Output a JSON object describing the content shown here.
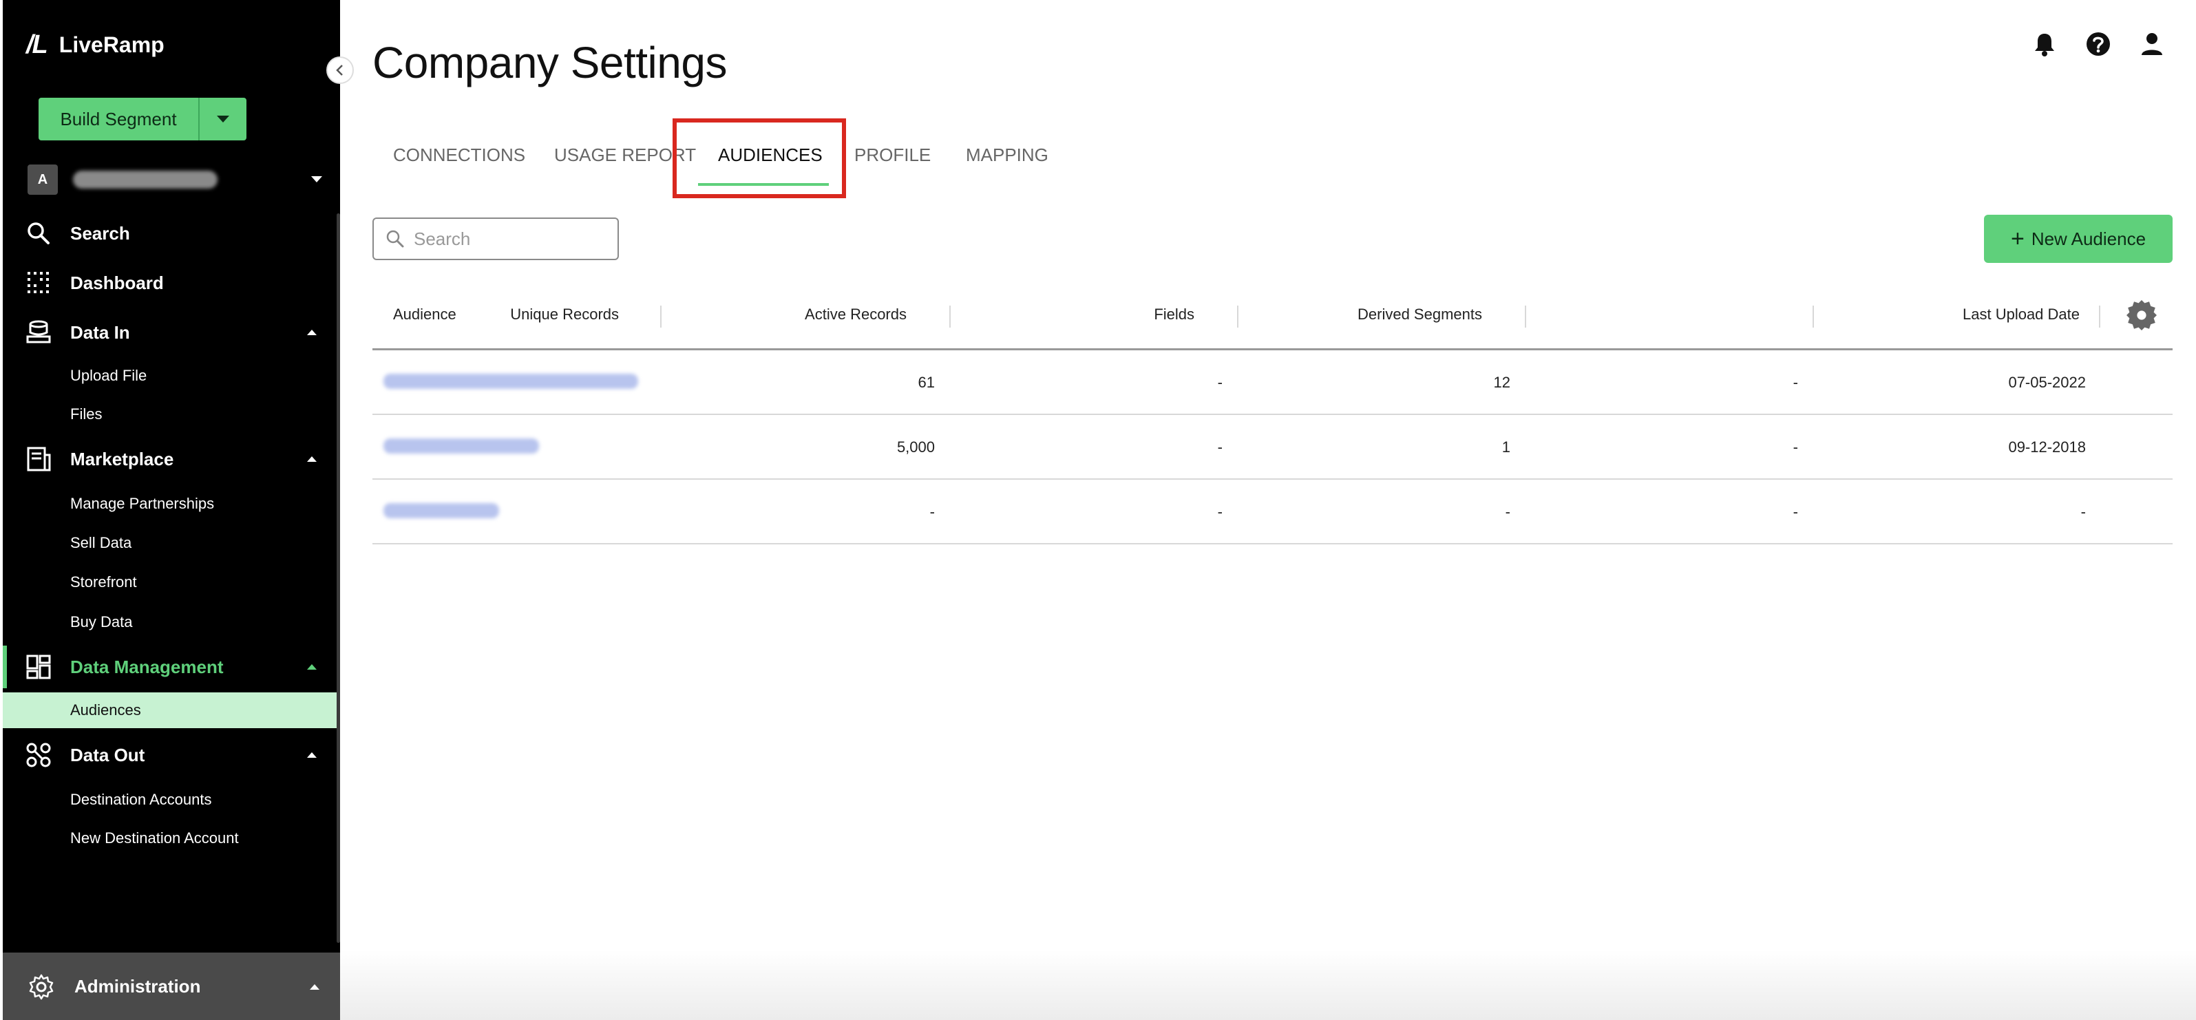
{
  "app": {
    "brand_mark": "/L",
    "brand_name": "LiveRamp"
  },
  "sidebar": {
    "build_segment_label": "Build Segment",
    "account_initial": "A",
    "nav": [
      {
        "label": "Search",
        "icon": "search-icon"
      },
      {
        "label": "Dashboard",
        "icon": "dashboard-icon"
      },
      {
        "label": "Data In",
        "icon": "data-in-icon",
        "expanded": true,
        "children": [
          "Upload File",
          "Files"
        ]
      },
      {
        "label": "Marketplace",
        "icon": "marketplace-icon",
        "expanded": true,
        "children": [
          "Manage Partnerships",
          "Sell Data",
          "Storefront",
          "Buy Data"
        ]
      },
      {
        "label": "Data Management",
        "icon": "data-management-icon",
        "expanded": true,
        "active": true,
        "children": [
          "Audiences"
        ],
        "active_child": "Audiences"
      },
      {
        "label": "Data Out",
        "icon": "data-out-icon",
        "expanded": true,
        "children": [
          "Destination Accounts",
          "New Destination Account"
        ]
      }
    ],
    "admin_label": "Administration"
  },
  "header": {
    "title": "Company Settings"
  },
  "tabs": [
    {
      "label": "CONNECTIONS"
    },
    {
      "label": "USAGE REPORT"
    },
    {
      "label": "AUDIENCES",
      "active": true
    },
    {
      "label": "PROFILE"
    },
    {
      "label": "MAPPING"
    }
  ],
  "toolbar": {
    "search_placeholder": "Search",
    "new_audience_label": "New Audience"
  },
  "table": {
    "columns": [
      "Audience",
      "Unique Records",
      "Active Records",
      "Fields",
      "Derived Segments",
      "Last Upload Date"
    ],
    "rows": [
      {
        "unique_records": "61",
        "active_records": "-",
        "fields": "12",
        "derived_segments": "-",
        "last_upload_date": "07-05-2022"
      },
      {
        "unique_records": "5,000",
        "active_records": "-",
        "fields": "1",
        "derived_segments": "-",
        "last_upload_date": "09-12-2018"
      },
      {
        "unique_records": "-",
        "active_records": "-",
        "fields": "-",
        "derived_segments": "-",
        "last_upload_date": "-"
      }
    ]
  },
  "colors": {
    "accent": "#5fd07b",
    "highlight": "#d9281f",
    "sidebar_bg": "#000000",
    "active_sub_bg": "#c7f2d2"
  }
}
